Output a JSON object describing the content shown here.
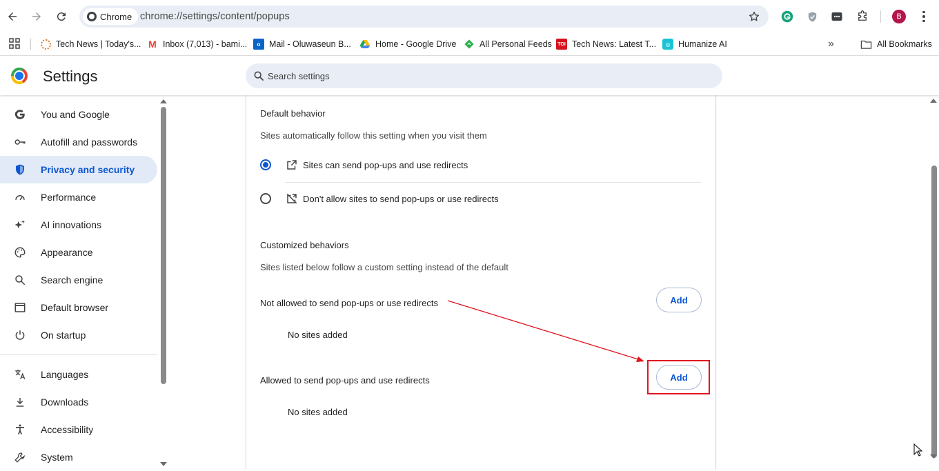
{
  "browser": {
    "chip_label": "Chrome",
    "url": "chrome://settings/content/popups",
    "profile_initial": "B"
  },
  "bookmarks": {
    "items": [
      {
        "label": "Tech News | Today's...",
        "icon": "sun-logo-icon",
        "color": "#e5731a"
      },
      {
        "label": "Inbox (7,013) - bami...",
        "icon": "gmail-icon",
        "color": "#ea4335"
      },
      {
        "label": "Mail - Oluwaseun B...",
        "icon": "outlook-icon",
        "color": "#0a64c8"
      },
      {
        "label": "Home - Google Drive",
        "icon": "drive-icon",
        "color": "#1ea362"
      },
      {
        "label": "All Personal Feeds",
        "icon": "feedly-icon",
        "color": "#2bb24c"
      },
      {
        "label": "Tech News: Latest T...",
        "icon": "toi-icon",
        "color": "#d5121e"
      },
      {
        "label": "Humanize AI",
        "icon": "humanize-icon",
        "color": "#19c3d6"
      }
    ],
    "more_label": "»",
    "all_bookmarks_label": "All Bookmarks"
  },
  "header": {
    "title": "Settings",
    "search_placeholder": "Search settings"
  },
  "sidebar": {
    "items": [
      {
        "label": "You and Google",
        "icon": "google-g-icon",
        "active": false
      },
      {
        "label": "Autofill and passwords",
        "icon": "key-icon",
        "active": false
      },
      {
        "label": "Privacy and security",
        "icon": "shield-icon",
        "active": true
      },
      {
        "label": "Performance",
        "icon": "speedometer-icon",
        "active": false
      },
      {
        "label": "AI innovations",
        "icon": "sparkle-icon",
        "active": false
      },
      {
        "label": "Appearance",
        "icon": "palette-icon",
        "active": false
      },
      {
        "label": "Search engine",
        "icon": "search-icon",
        "active": false
      },
      {
        "label": "Default browser",
        "icon": "browser-window-icon",
        "active": false
      },
      {
        "label": "On startup",
        "icon": "power-icon",
        "active": false
      },
      {
        "label": "Languages",
        "icon": "translate-icon",
        "active": false
      },
      {
        "label": "Downloads",
        "icon": "download-icon",
        "active": false
      },
      {
        "label": "Accessibility",
        "icon": "accessibility-icon",
        "active": false
      },
      {
        "label": "System",
        "icon": "wrench-icon",
        "active": false
      }
    ]
  },
  "content": {
    "default_behavior": {
      "title": "Default behavior",
      "subtitle": "Sites automatically follow this setting when you visit them",
      "options": [
        {
          "label": "Sites can send pop-ups and use redirects",
          "icon": "open-in-new-icon",
          "checked": true
        },
        {
          "label": "Don't allow sites to send pop-ups or use redirects",
          "icon": "popup-blocked-icon",
          "checked": false
        }
      ]
    },
    "customized": {
      "title": "Customized behaviors",
      "subtitle": "Sites listed below follow a custom setting instead of the default",
      "not_allowed": {
        "label": "Not allowed to send pop-ups or use redirects",
        "add_label": "Add",
        "empty_text": "No sites added"
      },
      "allowed": {
        "label": "Allowed to send pop-ups and use redirects",
        "add_label": "Add",
        "empty_text": "No sites added"
      }
    }
  },
  "colors": {
    "accent": "#0b57d0",
    "annotation": "#e0141e",
    "active_nav_bg": "#e2eaf8"
  }
}
